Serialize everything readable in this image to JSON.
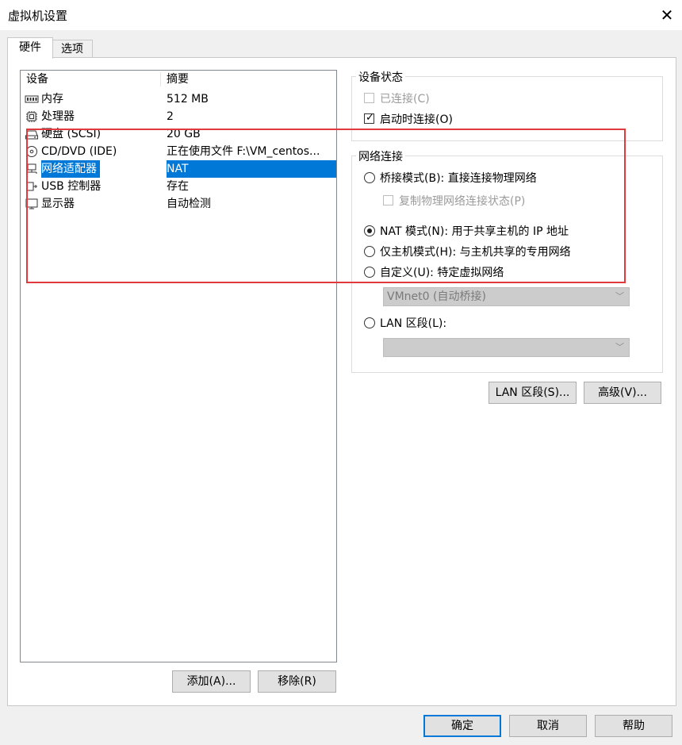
{
  "window": {
    "title": "虚拟机设置"
  },
  "tabs": [
    {
      "label": "硬件",
      "active": true
    },
    {
      "label": "选项",
      "active": false
    }
  ],
  "device_list": {
    "col_device": "设备",
    "col_summary": "摘要",
    "rows": [
      {
        "label": "内存",
        "summary": "512 MB",
        "icon": "memory-icon"
      },
      {
        "label": "处理器",
        "summary": "2",
        "icon": "cpu-icon"
      },
      {
        "label": "硬盘 (SCSI)",
        "summary": "20 GB",
        "icon": "harddisk-icon"
      },
      {
        "label": "CD/DVD (IDE)",
        "summary": "正在使用文件 F:\\VM_centos...",
        "icon": "cd-icon"
      },
      {
        "label": "网络适配器",
        "summary": "NAT",
        "icon": "network-adapter-icon",
        "selected": true
      },
      {
        "label": "USB 控制器",
        "summary": "存在",
        "icon": "usb-icon"
      },
      {
        "label": "显示器",
        "summary": "自动检测",
        "icon": "monitor-icon"
      }
    ]
  },
  "list_buttons": {
    "add": "添加(A)...",
    "add_key": "A",
    "remove": "移除(R)",
    "remove_key": "R"
  },
  "device_status": {
    "title": "设备状态",
    "connected": {
      "label": "已连接(C)",
      "checked": false,
      "disabled": true
    },
    "connect_at_power_on": {
      "label": "启动时连接(O)",
      "checked": true
    }
  },
  "network": {
    "title": "网络连接",
    "bridged": {
      "label": "桥接模式(B): 直接连接物理网络",
      "selected": false
    },
    "replicate": {
      "label": "复制物理网络连接状态(P)",
      "checked": false,
      "disabled": true
    },
    "nat": {
      "label": "NAT 模式(N): 用于共享主机的 IP 地址",
      "selected": true
    },
    "host_only": {
      "label": "仅主机模式(H): 与主机共享的专用网络",
      "selected": false
    },
    "custom": {
      "label": "自定义(U): 特定虚拟网络",
      "selected": false
    },
    "custom_dropdown": "VMnet0 (自动桥接)",
    "lan_segment": {
      "label": "LAN 区段(L):",
      "selected": false
    },
    "lan_dropdown": ""
  },
  "network_buttons": {
    "lan_segments": "LAN 区段(S)...",
    "advanced": "高级(V)..."
  },
  "footer": {
    "ok": "确定",
    "cancel": "取消",
    "help": "帮助"
  },
  "colors": {
    "selection": "#0078d7",
    "highlight_box": "#e0393e"
  }
}
